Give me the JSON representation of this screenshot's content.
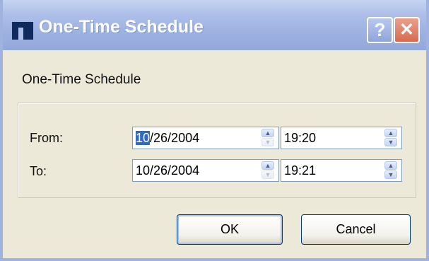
{
  "window": {
    "title": "One-Time Schedule",
    "help_glyph": "?",
    "close_glyph": "✕",
    "logo_icon": "app-logo-icon"
  },
  "dialog": {
    "heading": "One-Time Schedule",
    "from": {
      "label": "From:",
      "date_highlight": "10",
      "date_rest": "/26/2004",
      "time": "19:20"
    },
    "to": {
      "label": "To:",
      "date": "10/26/2004",
      "time": "19:21"
    },
    "buttons": {
      "ok": "OK",
      "cancel": "Cancel"
    }
  },
  "icons": {
    "spin_up": "▲",
    "spin_down": "▼"
  },
  "colors": {
    "title_bar": "#9fb3e2",
    "dialog_bg": "#ece9d8",
    "selection": "#316ac5",
    "close_button": "#d96a50"
  }
}
